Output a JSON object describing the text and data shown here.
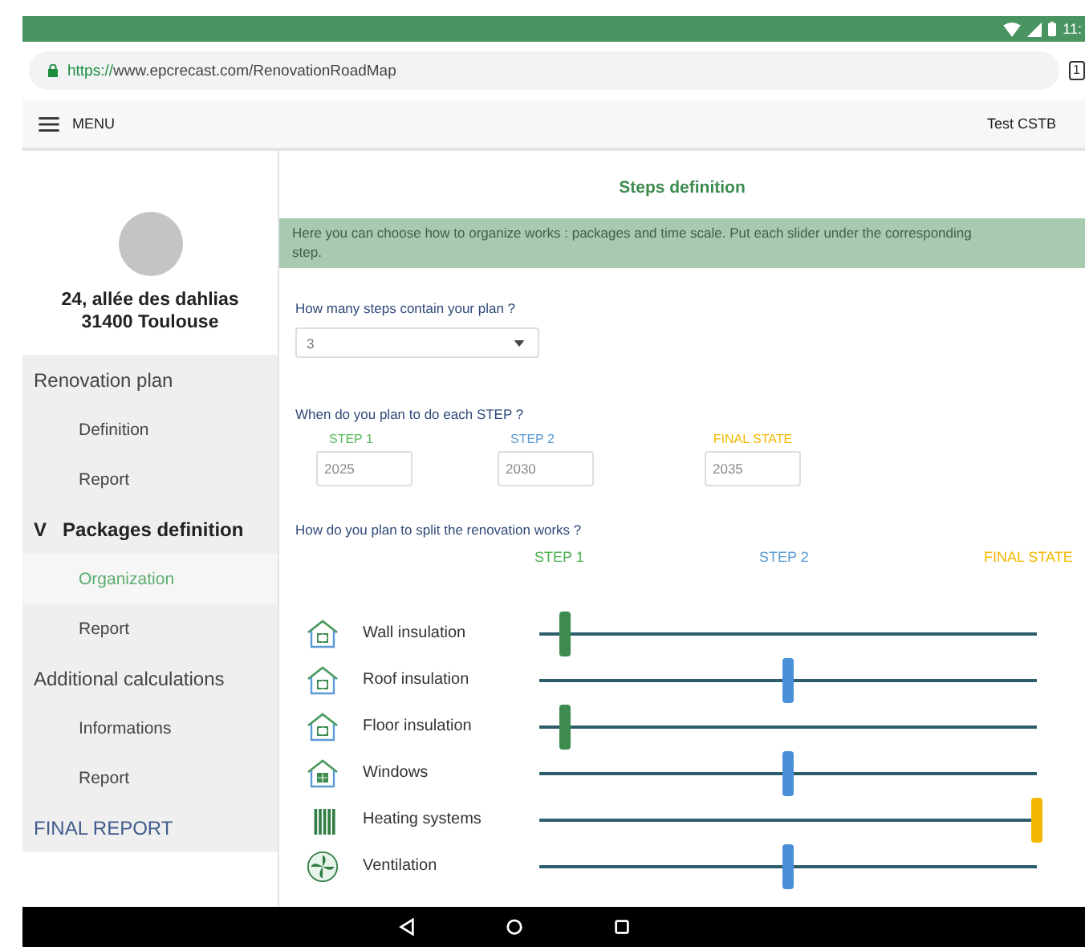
{
  "status_bar": {
    "time": "11:"
  },
  "browser": {
    "scheme": "https://",
    "url": "www.epcrecast.com/RenovationRoadMap",
    "tab_count": "1"
  },
  "app_bar": {
    "menu": "MENU",
    "user": "Test CSTB"
  },
  "sidebar": {
    "address": [
      "24, allée des dahlias",
      "31400 Toulouse"
    ],
    "items": [
      {
        "label": "Renovation plan",
        "kind": "section",
        "selected": false
      },
      {
        "label": "Definition",
        "kind": "sub",
        "selected": false
      },
      {
        "label": "Report",
        "kind": "sub",
        "selected": false
      },
      {
        "label": "Packages definition",
        "marker": "V",
        "kind": "section",
        "selected": false
      },
      {
        "label": "Organization",
        "kind": "sub",
        "selected": true
      },
      {
        "label": "Report",
        "kind": "sub",
        "selected": false
      },
      {
        "label": "Additional calculations",
        "kind": "section",
        "selected": false
      },
      {
        "label": "Informations",
        "kind": "sub",
        "selected": false
      },
      {
        "label": "Report",
        "kind": "sub",
        "selected": false
      },
      {
        "label": "FINAL REPORT",
        "kind": "final",
        "selected": false
      }
    ]
  },
  "main": {
    "title": "Steps definition",
    "info": "Here you can choose how to organize works : packages and time scale. Put each slider under the corresponding step.",
    "steps_question": "How many steps contain your plan ?",
    "steps_value": "3",
    "when_question": "When do you plan to do each STEP ?",
    "steps": [
      {
        "label": "STEP 1",
        "color": "#5cb85c",
        "year": "2025"
      },
      {
        "label": "STEP 2",
        "color": "#5b9bd5",
        "year": "2030"
      },
      {
        "label": "FINAL STATE",
        "color": "#f5b800",
        "year": "2035"
      }
    ],
    "split_question": "How do you plan to split the renovation works ?",
    "split_steps": [
      {
        "label": "STEP 1",
        "color": "#4caf50"
      },
      {
        "label": "STEP 2",
        "color": "#5b9bd5"
      },
      {
        "label": "FINAL STATE",
        "color": "#f5b800"
      }
    ],
    "works": [
      {
        "label": "Wall insulation",
        "kind": "house",
        "level": 0.05,
        "color": "#3d8b4f"
      },
      {
        "label": "Roof insulation",
        "kind": "house",
        "level": 0.5,
        "color": "#4a90d9"
      },
      {
        "label": "Floor insulation",
        "kind": "house",
        "level": 0.05,
        "color": "#3d8b4f"
      },
      {
        "label": "Windows",
        "kind": "window",
        "level": 0.5,
        "color": "#4a90d9"
      },
      {
        "label": "Heating systems",
        "kind": "radiator",
        "level": 1.0,
        "color": "#f2b705"
      },
      {
        "label": "Ventilation",
        "kind": "fan",
        "level": 0.5,
        "color": "#4a90d9"
      }
    ]
  }
}
